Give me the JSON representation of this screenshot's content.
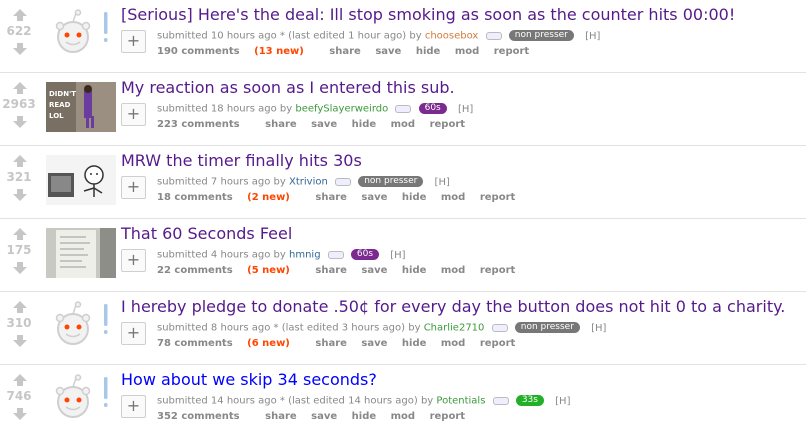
{
  "posts": [
    {
      "score": "622",
      "title": "[Serious] Here's the deal: Ill stop smoking as soon as the counter hits 00:00!",
      "submitted": "submitted 10 hours ago * (last edited 1 hour ago) by",
      "author": "choosebox",
      "flair": "non presser",
      "h": "[H]",
      "comments": "190 comments",
      "new": "(13 new)",
      "actions": [
        "share",
        "save",
        "hide",
        "mod",
        "report"
      ],
      "thumb": "default-snoo",
      "visited": true
    },
    {
      "score": "2963",
      "title": "My reaction as soon as I entered this sub.",
      "submitted": "submitted 18 hours ago by",
      "author": "beefySlayerweirdo",
      "flair": "60s",
      "h": "[H]",
      "comments": "223 comments",
      "new": "",
      "actions": [
        "share",
        "save",
        "hide",
        "mod",
        "report"
      ],
      "thumb": "meme-didnt-read",
      "thumb_text": [
        "DIDN'T",
        "READ",
        "LOL"
      ],
      "visited": true
    },
    {
      "score": "321",
      "title": "MRW the timer finally hits 30s",
      "submitted": "submitted 7 hours ago by",
      "author": "Xtrivion",
      "flair": "non presser",
      "h": "[H]",
      "comments": "18 comments",
      "new": "(2 new)",
      "actions": [
        "share",
        "save",
        "hide",
        "mod",
        "report"
      ],
      "thumb": "comic-stickman",
      "visited": true
    },
    {
      "score": "175",
      "title": "That 60 Seconds Feel",
      "submitted": "submitted 4 hours ago by",
      "author": "hmnig",
      "flair": "60s",
      "h": "[H]",
      "comments": "22 comments",
      "new": "(5 new)",
      "actions": [
        "share",
        "save",
        "hide",
        "mod",
        "report"
      ],
      "thumb": "paper-note",
      "visited": true
    },
    {
      "score": "310",
      "title": "I hereby pledge to donate .50¢ for every day the button does not hit 0 to a charity.",
      "submitted": "submitted 8 hours ago * (last edited 3 hours ago) by",
      "author": "Charlie2710",
      "flair": "non presser",
      "h": "[H]",
      "comments": "78 comments",
      "new": "(6 new)",
      "actions": [
        "share",
        "save",
        "hide",
        "mod",
        "report"
      ],
      "thumb": "default-snoo",
      "visited": true
    },
    {
      "score": "746",
      "title": "How about we skip 34 seconds?",
      "submitted": "submitted 14 hours ago * (last edited 14 hours ago) by",
      "author": "Potentials",
      "flair": "33s",
      "h": "[H]",
      "comments": "352 comments",
      "new": "",
      "actions": [
        "share",
        "save",
        "hide",
        "mod",
        "report"
      ],
      "thumb": "default-snoo",
      "visited": false
    }
  ],
  "colors": {
    "visited_title": "#551a8b",
    "unvisited_title": "#0000ff",
    "new_comments": "#ff4500",
    "flair_grey": "#777777",
    "flair_purple": "#7b2a8f",
    "flair_green": "#22b026"
  },
  "icons": {
    "upvote": "upvote-arrow-icon",
    "downvote": "downvote-arrow-icon",
    "expand": "plus-expando-icon"
  }
}
